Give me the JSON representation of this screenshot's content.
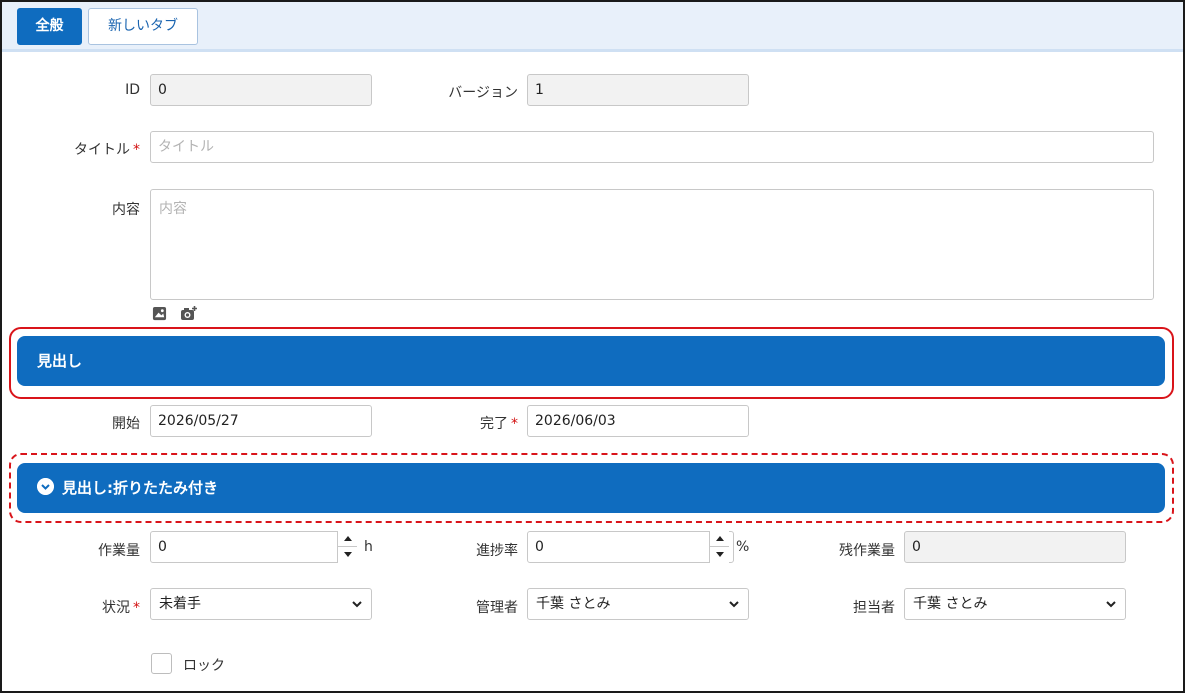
{
  "tabs": [
    {
      "label": "全般",
      "active": true
    },
    {
      "label": "新しいタブ",
      "active": false
    }
  ],
  "fields": {
    "id": {
      "label": "ID",
      "value": "0"
    },
    "version": {
      "label": "バージョン",
      "value": "1"
    },
    "title": {
      "label": "タイトル",
      "placeholder": "タイトル",
      "required": "*"
    },
    "content": {
      "label": "内容",
      "placeholder": "内容"
    },
    "start": {
      "label": "開始",
      "value": "2026/05/27"
    },
    "end": {
      "label": "完了",
      "value": "2026/06/03",
      "required": "*"
    },
    "work": {
      "label": "作業量",
      "value": "0",
      "unit": "h"
    },
    "progress": {
      "label": "進捗率",
      "value": "0",
      "unit": "%"
    },
    "remaining": {
      "label": "残作業量",
      "value": "0"
    },
    "status": {
      "label": "状況",
      "value": "未着手",
      "required": "*"
    },
    "manager": {
      "label": "管理者",
      "value": "千葉 さとみ"
    },
    "owner": {
      "label": "担当者",
      "value": "千葉 さとみ"
    },
    "lock": {
      "label": "ロック",
      "checked": false
    }
  },
  "headings": {
    "plain": "見出し",
    "collapsible": "見出し:折りたたみ付き"
  },
  "colors": {
    "accent": "#0f6cbf",
    "highlight": "#d9141a",
    "required": "#d20f0f"
  },
  "icons": [
    "image-icon",
    "camera-add-icon",
    "chevron-down-icon",
    "spinner-up-icon",
    "spinner-down-icon",
    "select-caret-icon"
  ]
}
